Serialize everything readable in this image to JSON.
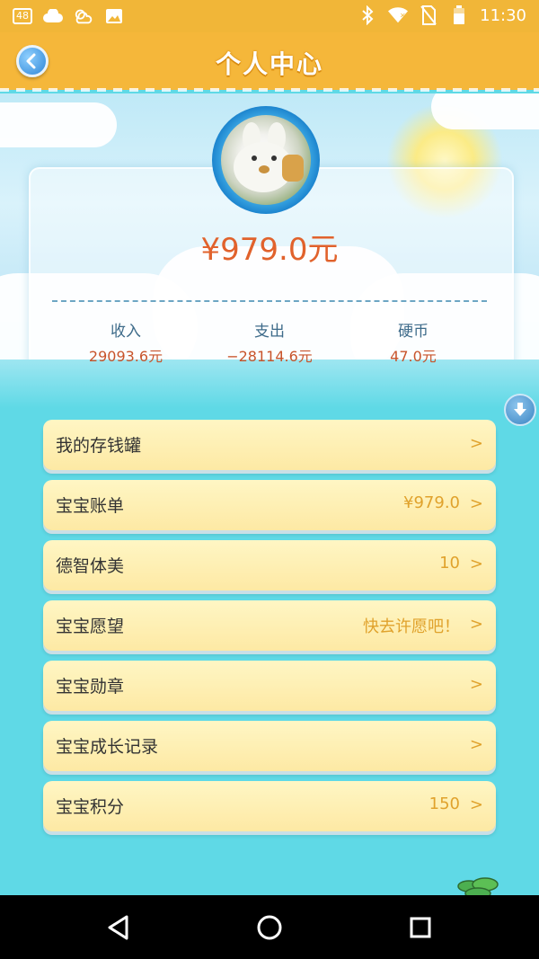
{
  "status_bar": {
    "badge": "48",
    "time": "11:30",
    "icons": [
      "badge-icon",
      "cloud-icon",
      "weather-icon",
      "image-icon",
      "bluetooth-icon",
      "wifi-icon",
      "no-sim-icon",
      "battery-icon"
    ]
  },
  "header": {
    "title": "个人中心",
    "back_icon": "back-icon"
  },
  "profile": {
    "balance": "¥979.0元",
    "stats": [
      {
        "label": "收入",
        "value": "29093.6元"
      },
      {
        "label": "支出",
        "value": "−28114.6元"
      },
      {
        "label": "硬币",
        "value": "47.0元"
      }
    ]
  },
  "menu": {
    "items": [
      {
        "label": "我的存钱罐",
        "value": "",
        "chevron": ">"
      },
      {
        "label": "宝宝账单",
        "value": "¥979.0",
        "chevron": ">"
      },
      {
        "label": "德智体美",
        "value": "10",
        "chevron": ">"
      },
      {
        "label": "宝宝愿望",
        "value": "快去许愿吧！",
        "chevron": ">"
      },
      {
        "label": "宝宝勋章",
        "value": "",
        "chevron": ">"
      },
      {
        "label": "宝宝成长记录",
        "value": "",
        "chevron": ">"
      },
      {
        "label": "宝宝积分",
        "value": "150",
        "chevron": ">"
      }
    ]
  },
  "colors": {
    "header_bg": "#f5b73a",
    "balance": "#e1622c",
    "stat_value": "#c8542b",
    "item_value": "#e0a22c"
  },
  "nav": {
    "icons": [
      "back-triangle-icon",
      "home-circle-icon",
      "recents-square-icon"
    ]
  }
}
